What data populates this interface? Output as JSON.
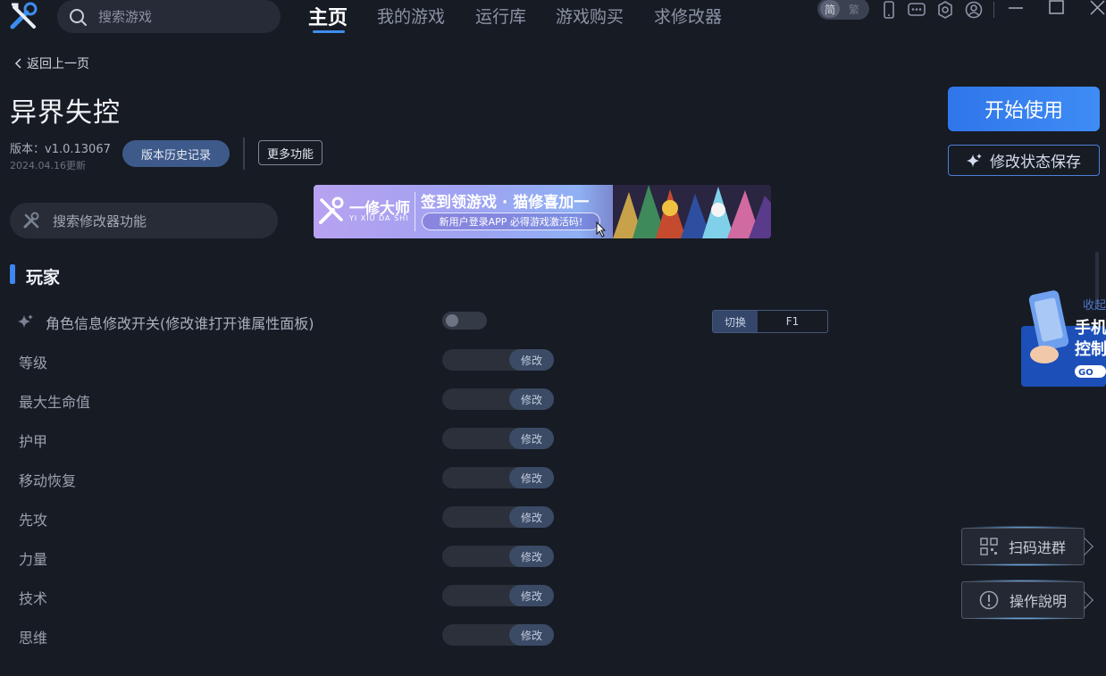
{
  "app": {
    "search_placeholder": "搜索游戏",
    "nav": [
      {
        "label": "主页",
        "active": true
      },
      {
        "label": "我的游戏",
        "active": false
      },
      {
        "label": "运行库",
        "active": false
      },
      {
        "label": "游戏购买",
        "active": false
      },
      {
        "label": "求修改器",
        "active": false
      }
    ],
    "lang": {
      "simplified": "简",
      "traditional": "繁"
    },
    "icons": [
      "phone-icon",
      "message-icon",
      "settings-icon",
      "user-icon"
    ],
    "window_buttons": [
      "minimize-icon",
      "maximize-icon",
      "close-icon"
    ],
    "accent": "#3d8ef0"
  },
  "header": {
    "back_label": "返回上一页",
    "game_title": "异界失控",
    "version": "版本：v1.0.13067",
    "update_date": "2024.04.16更新",
    "history_button": "版本历史记录",
    "more_button": "更多功能",
    "start_button": "开始使用",
    "save_button": "修改状态保存"
  },
  "search_func": {
    "placeholder": "搜索修改器功能"
  },
  "banner": {
    "brand": "一修大师",
    "brand_pinyin": "YI XIU DA SHI",
    "headline": "签到领游戏 · 猫修喜加一",
    "subline": "新用户登录APP  必得游戏激活码!"
  },
  "section": {
    "title": "玩家",
    "first_row": {
      "label": "角色信息修改开关(修改谁打开谁属性面板)",
      "enabled": false,
      "hotkey_action": "切换",
      "hotkey": "F1"
    },
    "rows": [
      {
        "label": "等级",
        "button": "修改"
      },
      {
        "label": "最大生命值",
        "button": "修改"
      },
      {
        "label": "护甲",
        "button": "修改"
      },
      {
        "label": "移动恢复",
        "button": "修改"
      },
      {
        "label": "先攻",
        "button": "修改"
      },
      {
        "label": "力量",
        "button": "修改"
      },
      {
        "label": "技术",
        "button": "修改"
      },
      {
        "label": "思维",
        "button": "修改"
      }
    ]
  },
  "side": {
    "promo_collapse": "收起",
    "promo_text_1": "手机",
    "promo_text_2": "控制",
    "promo_go": "GO",
    "qr_button": "扫码进群",
    "help_button": "操作說明"
  }
}
